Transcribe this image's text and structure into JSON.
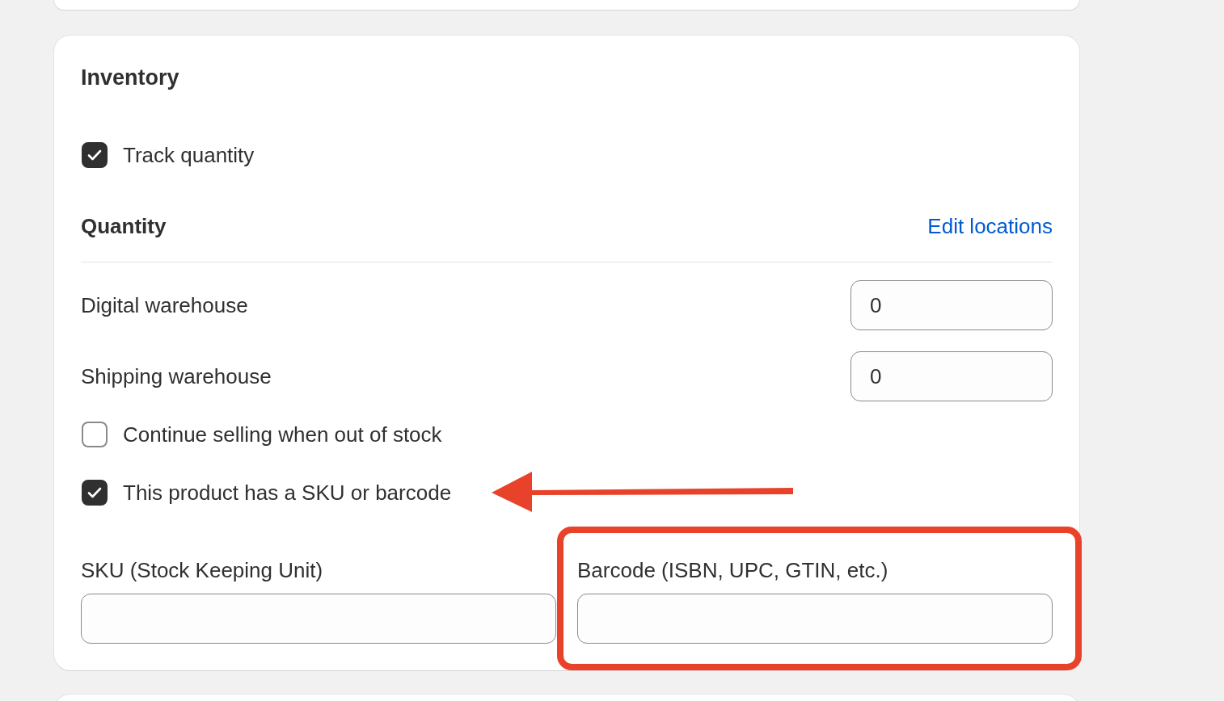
{
  "section": {
    "title": "Inventory"
  },
  "track_quantity": {
    "label": "Track quantity",
    "checked": true
  },
  "quantity": {
    "title": "Quantity",
    "link": "Edit locations"
  },
  "locations": [
    {
      "name": "Digital warehouse",
      "value": "0"
    },
    {
      "name": "Shipping warehouse",
      "value": "0"
    }
  ],
  "options": [
    {
      "label": "Continue selling when out of stock",
      "checked": false,
      "arrow": false
    },
    {
      "label": "This product has a SKU or barcode",
      "checked": true,
      "arrow": true
    }
  ],
  "fields": [
    {
      "label": "SKU (Stock Keeping Unit)",
      "highlighted": false
    },
    {
      "label": "Barcode (ISBN, UPC, GTIN, etc.)",
      "highlighted": true
    }
  ]
}
